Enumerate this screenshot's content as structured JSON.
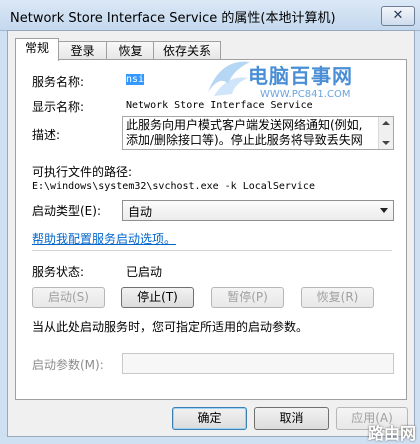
{
  "window": {
    "title": "Network Store Interface Service 的属性(本地计算机)",
    "close_glyph": "✕"
  },
  "tabs": [
    "常规",
    "登录",
    "恢复",
    "依存关系"
  ],
  "general": {
    "service_name_label": "服务名称:",
    "service_name_value": "nsi",
    "display_name_label": "显示名称:",
    "display_name_value": "Network Store Interface Service",
    "description_label": "描述:",
    "description_line1": "此服务向用户模式客户端发送网络通知(例如,",
    "description_line2": "添加/删除接口等)。停止此服务将导致丢失网",
    "exe_path_label": "可执行文件的路径:",
    "exe_path_value": "E:\\windows\\system32\\svchost.exe -k LocalService",
    "startup_type_label": "启动类型(E):",
    "startup_type_value": "自动",
    "help_link": "帮助我配置服务启动选项。",
    "status_label": "服务状态:",
    "status_value": "已启动",
    "btn_start": "启动(S)",
    "btn_stop": "停止(T)",
    "btn_pause": "暂停(P)",
    "btn_resume": "恢复(R)",
    "hint": "当从此处启动服务时，您可指定所适用的启动参数。",
    "start_params_label": "启动参数(M):",
    "start_params_value": ""
  },
  "footer": {
    "ok": "确定",
    "cancel": "取消",
    "apply": "应用(A)"
  },
  "watermark": {
    "text": "电脑百事网",
    "url": "WWW.PC841.COM",
    "corner": "路由网"
  }
}
